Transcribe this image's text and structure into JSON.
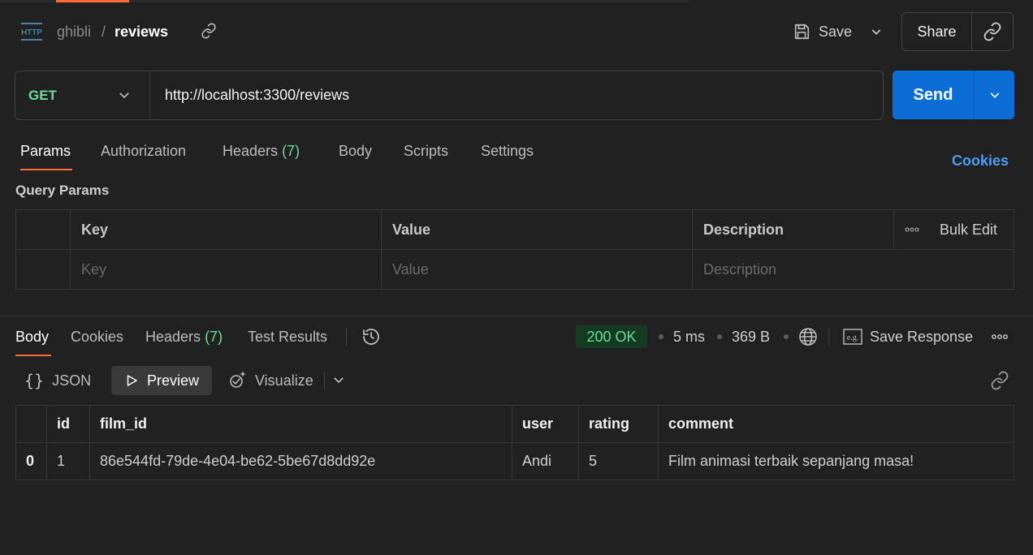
{
  "header": {
    "icon": "http-icon",
    "breadcrumb_parent": "ghibli",
    "breadcrumb_sep": "/",
    "breadcrumb_current": "reviews",
    "save_label": "Save",
    "share_label": "Share"
  },
  "request": {
    "method": "GET",
    "url": "http://localhost:3300/reviews",
    "send_label": "Send"
  },
  "request_tabs": {
    "params": "Params",
    "authorization": "Authorization",
    "headers": "Headers",
    "headers_count": "(7)",
    "body": "Body",
    "scripts": "Scripts",
    "settings": "Settings",
    "cookies": "Cookies"
  },
  "query_params": {
    "title": "Query Params",
    "columns": [
      "Key",
      "Value",
      "Description"
    ],
    "bulk_edit": "Bulk Edit",
    "placeholders": [
      "Key",
      "Value",
      "Description"
    ]
  },
  "response_tabs": {
    "body": "Body",
    "cookies": "Cookies",
    "headers": "Headers",
    "headers_count": "(7)",
    "test_results": "Test Results"
  },
  "response_meta": {
    "status": "200 OK",
    "time": "5 ms",
    "size": "369 B",
    "save_response": "Save Response"
  },
  "view_modes": {
    "json": "JSON",
    "preview": "Preview",
    "visualize": "Visualize"
  },
  "result_table": {
    "columns": [
      "id",
      "film_id",
      "user",
      "rating",
      "comment"
    ],
    "rows": [
      {
        "index": "0",
        "id": "1",
        "film_id": "86e544fd-79de-4e04-be62-5be67d8dd92e",
        "user": "Andi",
        "rating": "5",
        "comment": "Film animasi terbaik sepanjang masa!"
      }
    ]
  },
  "colors": {
    "accent": "#ff6c37",
    "send_button": "#0b6dd6",
    "method_get": "#6bdd9a",
    "status_ok": "#6bdd9a",
    "link": "#4d9ef5"
  }
}
